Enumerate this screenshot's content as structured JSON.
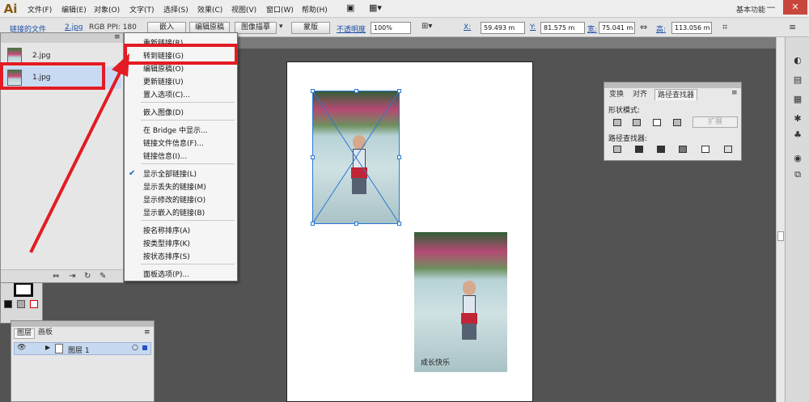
{
  "app": {
    "logo": "Ai"
  },
  "menubar": {
    "items": [
      "文件(F)",
      "编辑(E)",
      "对象(O)",
      "文字(T)",
      "选择(S)",
      "效果(C)",
      "视图(V)",
      "窗口(W)",
      "帮助(H)"
    ],
    "workspace": "基本功能",
    "minimize": "—",
    "close": "✕"
  },
  "control_bar": {
    "linked_file": "链接的文件",
    "file_name": "2.jpg",
    "color_info": "RGB  PPI: 180",
    "embed": "嵌入",
    "edit_original": "编辑原稿",
    "image_trace": "图像描摹",
    "mask": "蒙版",
    "opacity_label": "不透明度",
    "opacity_value": "100%",
    "x_label": "X:",
    "x_value": "59.493 m",
    "y_label": "Y:",
    "y_value": "81.575 m",
    "w_label": "宽:",
    "w_value": "75.041 m",
    "h_label": "高:",
    "h_value": "113.056 m"
  },
  "links_panel": {
    "items": [
      {
        "name": "2.jpg"
      },
      {
        "name": "1.jpg"
      }
    ]
  },
  "context_menu": {
    "items": [
      "重新链接(R)...",
      "转到链接(G)",
      "编辑原稿(O)",
      "更新链接(U)",
      "置入选项(C)...",
      "嵌入图像(D)",
      "在 Bridge 中显示...",
      "链接文件信息(F)...",
      "链接信息(I)...",
      "显示全部链接(L)",
      "显示丢失的链接(M)",
      "显示修改的链接(O)",
      "显示嵌入的链接(B)",
      "按名称排序(A)",
      "按类型排序(K)",
      "按状态排序(S)",
      "面板选项(P)..."
    ]
  },
  "pathfinder": {
    "tabs": [
      "变换",
      "对齐",
      "路径查找器"
    ],
    "shape_modes": "形状模式:",
    "expand": "扩展",
    "pathfinders": "路径查找器:"
  },
  "layers_panel": {
    "tabs": [
      "图层",
      "画板"
    ],
    "layer_name": "图层 1"
  },
  "artboard": {
    "caption": "成长快乐"
  },
  "colors": {
    "highlight": "#e31b23",
    "selection": "#2a78d4",
    "link_text": "#1a4fa8"
  }
}
